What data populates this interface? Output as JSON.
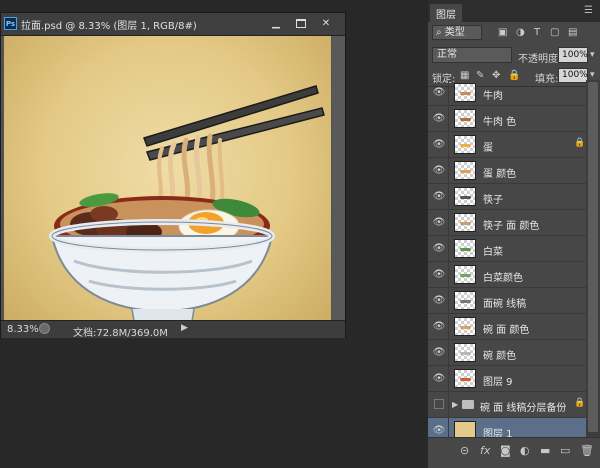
{
  "document": {
    "title": "拉面.psd @ 8.33% (图层 1, RGB/8#)",
    "ps_badge": "Ps",
    "zoom": "8.33%",
    "doc_info": "文档:72.8M/369.0M",
    "minimize_glyph": "▁",
    "close_glyph": "✕",
    "status_arrow_glyph": "▶"
  },
  "layers_panel": {
    "tab_label": "图层",
    "menu_glyph": "☰",
    "filter_kind": "类型",
    "filter_icons": [
      "image-filter-icon",
      "adjustment-filter-icon",
      "type-filter-icon",
      "shape-filter-icon",
      "smartobject-filter-icon"
    ],
    "filter_glyphs": [
      "▣",
      "◑",
      "T",
      "▢",
      "▤"
    ],
    "blend_mode": "正常",
    "opacity_label": "不透明度:",
    "opacity_value": "100%",
    "lock_label": "锁定:",
    "lock_glyphs": [
      "▦",
      "✎",
      "✥",
      "🔒"
    ],
    "fill_label": "填充:",
    "fill_value": "100%",
    "eye_glyph": "👁",
    "layers": [
      {
        "name": "牛肉",
        "visible": true,
        "locked": false
      },
      {
        "name": "牛肉 色",
        "visible": true,
        "locked": false
      },
      {
        "name": "蛋",
        "visible": true,
        "locked": true
      },
      {
        "name": "蛋 颜色",
        "visible": true,
        "locked": false
      },
      {
        "name": "筷子",
        "visible": true,
        "locked": false
      },
      {
        "name": "筷子 面 颜色",
        "visible": true,
        "locked": false
      },
      {
        "name": "白菜",
        "visible": true,
        "locked": false
      },
      {
        "name": "白菜颜色",
        "visible": true,
        "locked": false
      },
      {
        "name": "面碗 线稿",
        "visible": true,
        "locked": false
      },
      {
        "name": "碗 面 颜色",
        "visible": true,
        "locked": false
      },
      {
        "name": "碗 颜色",
        "visible": true,
        "locked": false
      },
      {
        "name": "图层 9",
        "visible": true,
        "locked": false
      },
      {
        "name": "碗 面 线稿分层备份",
        "visible": false,
        "locked": true,
        "is_group": true
      },
      {
        "name": "图层 1",
        "visible": true,
        "locked": false,
        "selected": true
      }
    ],
    "footer_icons": [
      "link-layers-icon",
      "fx-icon",
      "add-mask-icon",
      "adjustment-layer-icon",
      "new-group-icon",
      "new-layer-icon",
      "delete-layer-icon"
    ],
    "footer_glyphs": [
      "⊝",
      "fx",
      "◙",
      "◐",
      "▬",
      "▭",
      "🗑"
    ]
  }
}
